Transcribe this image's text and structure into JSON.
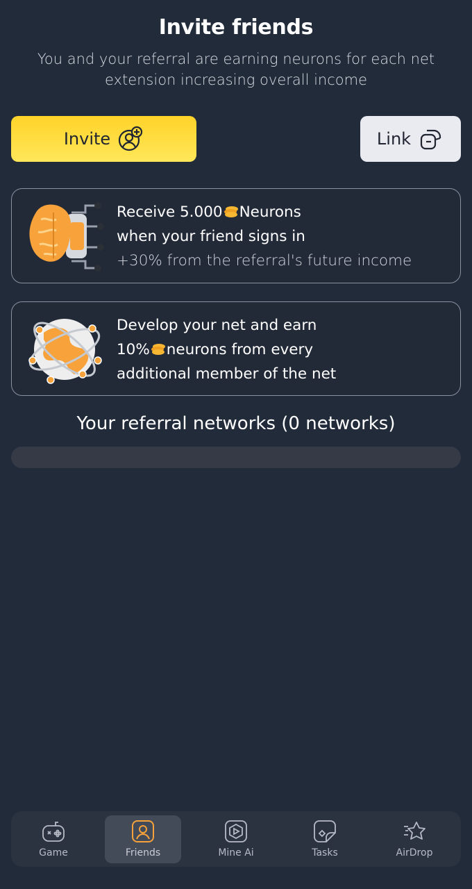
{
  "header": {
    "title": "Invite friends",
    "subtitle": "You and your referral are earning neurons for each net extension increasing overall income"
  },
  "buttons": {
    "invite_label": "Invite",
    "link_label": "Link"
  },
  "cards": [
    {
      "line1_pre": "Receive 5.000",
      "line1_post": "Neurons",
      "line2": "when your friend signs in",
      "line3": "+30% from the referral's future income"
    },
    {
      "line1": "Develop your net and earn",
      "line2_pre": "10%",
      "line2_post": "neurons from every",
      "line3": "additional member of the net"
    }
  ],
  "networks": {
    "title": "Your referral networks (0 networks)"
  },
  "nav": {
    "items": [
      {
        "label": "Game",
        "icon": "gamepad-icon"
      },
      {
        "label": "Friends",
        "icon": "user-icon",
        "active": true
      },
      {
        "label": "Mine Ai",
        "icon": "play-hexagon-icon"
      },
      {
        "label": "Tasks",
        "icon": "note-icon"
      },
      {
        "label": "AirDrop",
        "icon": "star-icon"
      }
    ]
  },
  "colors": {
    "background": "#212b3a",
    "accent_yellow": "#ffd329",
    "illustration_orange": "#f7a23b",
    "nav_bg": "#2b3240"
  }
}
